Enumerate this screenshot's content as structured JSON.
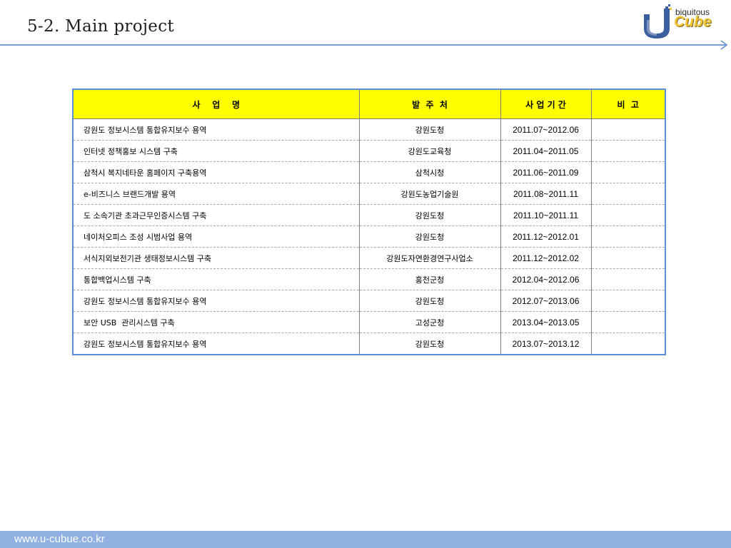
{
  "page": {
    "title": "5-2. Main project",
    "footer_url": "www.u-cubue.co.kr"
  },
  "logo": {
    "top_text": "biquitous",
    "main_text": "Cube",
    "letter": "U"
  },
  "table": {
    "headers": {
      "name": "사    업    명",
      "client": "발  주  처",
      "period": "사 업 기 간",
      "note": "비  고"
    },
    "rows": [
      {
        "name": "강원도 정보시스템 통합유지보수 용역",
        "client": "강원도청",
        "period": "2011.07~2012.06",
        "note": ""
      },
      {
        "name": "인터넷 정책홍보 시스템 구축",
        "client": "강원도교육청",
        "period": "2011.04~2011.05",
        "note": ""
      },
      {
        "name": "삼척시 복지네타운 홈페이지 구축용역",
        "client": "삼척시청",
        "period": "2011.06~2011.09",
        "note": ""
      },
      {
        "name": "e-비즈니스 브랜드개발 용역",
        "client": "강원도농업기술원",
        "period": "2011.08~2011.11",
        "note": ""
      },
      {
        "name": "도 소속기관 초과근무인증시스템 구축",
        "client": "강원도청",
        "period": "2011.10~2011.11",
        "note": ""
      },
      {
        "name": "네이처오피스 조성 시범사업 용역",
        "client": "강원도청",
        "period": "2011.12~2012.01",
        "note": ""
      },
      {
        "name": "서식지외보전기관 생태정보시스템 구축",
        "client": "강원도자연환경연구사업소",
        "period": "2011.12~2012.02",
        "note": ""
      },
      {
        "name": "통합백업시스템 구축",
        "client": "홍천군청",
        "period": "2012.04~2012.06",
        "note": ""
      },
      {
        "name": "강원도 정보시스템 통합유지보수 용역",
        "client": "강원도청",
        "period": "2012.07~2013.06",
        "note": ""
      },
      {
        "name": "보안 USB  관리시스템 구축",
        "client": "고성군청",
        "period": "2013.04~2013.05",
        "note": ""
      },
      {
        "name": "강원도 정보시스템 통합유지보수 용역",
        "client": "강원도청",
        "period": "2013.07~2013.12",
        "note": ""
      }
    ]
  },
  "colors": {
    "header_bg": "#ffff00",
    "table_border": "#5b8fd6",
    "title_rule": "#4a7fc4",
    "footer_bg": "#8fb0e0",
    "logo_blue": "#3a5f9e",
    "logo_yellow": "#f2c430"
  }
}
